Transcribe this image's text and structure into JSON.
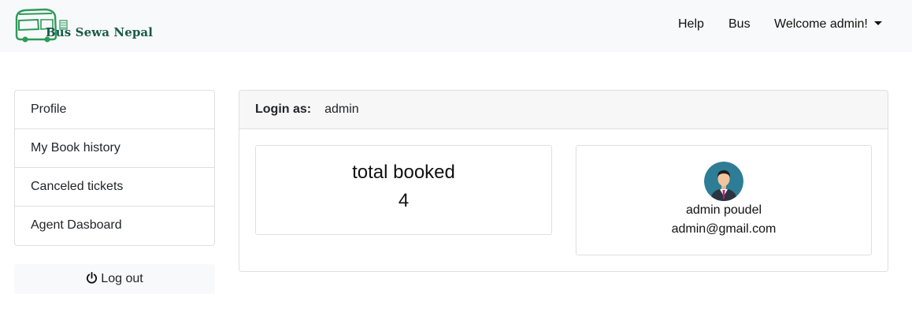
{
  "brand": {
    "name": "Bus Sewa Nepal",
    "logo_icon": "bus-logo-icon",
    "color": "#1a5a4a"
  },
  "navbar": {
    "help_label": "Help",
    "bus_label": "Bus",
    "user_label": "Welcome admin!"
  },
  "sidebar": {
    "items": [
      {
        "label": "Profile"
      },
      {
        "label": "My Book history"
      },
      {
        "label": "Canceled tickets"
      },
      {
        "label": "Agent Dasboard"
      }
    ],
    "logout_label": "Log out",
    "logout_icon": "power-icon"
  },
  "main": {
    "header_label": "Login as:",
    "header_value": "admin",
    "stat": {
      "title": "total booked",
      "value": "4"
    },
    "profile": {
      "name": "admin poudel",
      "email": "admin@gmail.com",
      "avatar_icon": "avatar-icon"
    }
  }
}
